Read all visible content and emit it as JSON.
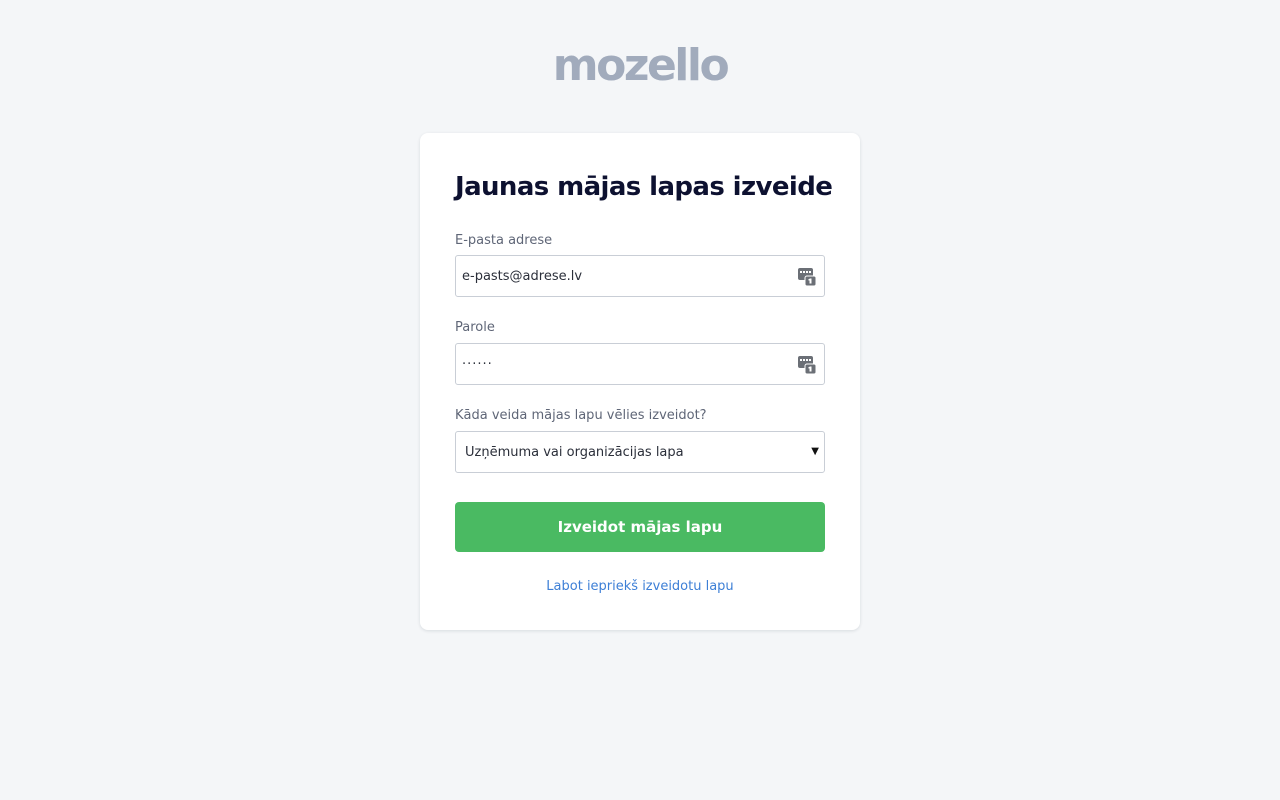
{
  "brand": {
    "logo_text": "mozello"
  },
  "form": {
    "title": "Jaunas mājas lapas izveide",
    "email": {
      "label": "E-pasta adrese",
      "value": "e-pasts@adrese.lv"
    },
    "password": {
      "label": "Parole",
      "value": "······"
    },
    "site_type": {
      "label": "Kāda veida mājas lapu vēlies izveidot?",
      "selected": "Uzņēmuma vai organizācijas lapa"
    },
    "submit_label": "Izveidot mājas lapu",
    "edit_link": "Labot iepriekš izveidotu lapu"
  },
  "colors": {
    "background": "#f4f6f8",
    "card": "#ffffff",
    "logo": "#a1abbc",
    "title": "#0d1130",
    "primary_button": "#4aba62",
    "link": "#3d7fd6"
  },
  "icons": {
    "field_icon": "password-manager-icon",
    "select_caret": "caret-down-icon"
  }
}
